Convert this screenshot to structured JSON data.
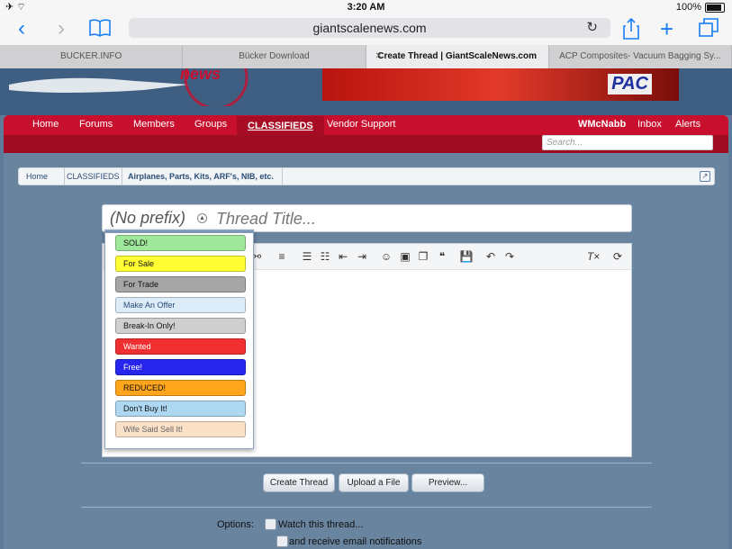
{
  "status": {
    "time": "3:20 AM",
    "battery": "100%"
  },
  "browser": {
    "url": "giantscalenews.com",
    "tabs": [
      {
        "label": "BUCKER.INFO",
        "active": false
      },
      {
        "label": "Bücker Download",
        "active": false
      },
      {
        "label": "Create Thread | GiantScaleNews.com",
        "active": true
      },
      {
        "label": "ACP Composites- Vacuum Bagging Sy...",
        "active": false
      }
    ]
  },
  "site": {
    "logo_text": "news",
    "banner_text": "PAC"
  },
  "nav": {
    "items": [
      "Home",
      "Forums",
      "Members",
      "Groups",
      "CLASSIFIEDS",
      "Vendor Support"
    ],
    "user": "WMcNabb",
    "inbox": "Inbox",
    "alerts": "Alerts",
    "search_placeholder": "Search..."
  },
  "breadcrumb": [
    "Home",
    "CLASSIFIEDS",
    "Airplanes, Parts, Kits, ARF's, NIB, etc."
  ],
  "form": {
    "prefix": "(No prefix)",
    "title_placeholder": "Thread Title...",
    "prefixes": [
      {
        "label": "SOLD!",
        "bg": "#9fe79a",
        "color": "#111"
      },
      {
        "label": "For Sale",
        "bg": "#ffff33",
        "color": "#111"
      },
      {
        "label": "For Trade",
        "bg": "#a6a6a6",
        "color": "#111"
      },
      {
        "label": "Make An Offer",
        "bg": "#dcecf9",
        "color": "#2b4d75"
      },
      {
        "label": "Break-In Only!",
        "bg": "#cfcfcf",
        "color": "#111"
      },
      {
        "label": "Wanted",
        "bg": "#f03030",
        "color": "#ffffff"
      },
      {
        "label": "Free!",
        "bg": "#2525ee",
        "color": "#ffffff"
      },
      {
        "label": "REDUCED!",
        "bg": "#ffa51c",
        "color": "#111"
      },
      {
        "label": "Don't Buy It!",
        "bg": "#aed8f2",
        "color": "#111"
      },
      {
        "label": "Wife Said Sell It!",
        "bg": "#fbe0c8",
        "color": "#666"
      }
    ],
    "buttons": {
      "create": "Create Thread",
      "upload": "Upload a File",
      "preview": "Preview..."
    },
    "options_label": "Options:",
    "watch_label": "Watch this thread...",
    "email_label": "and receive email notifications"
  }
}
